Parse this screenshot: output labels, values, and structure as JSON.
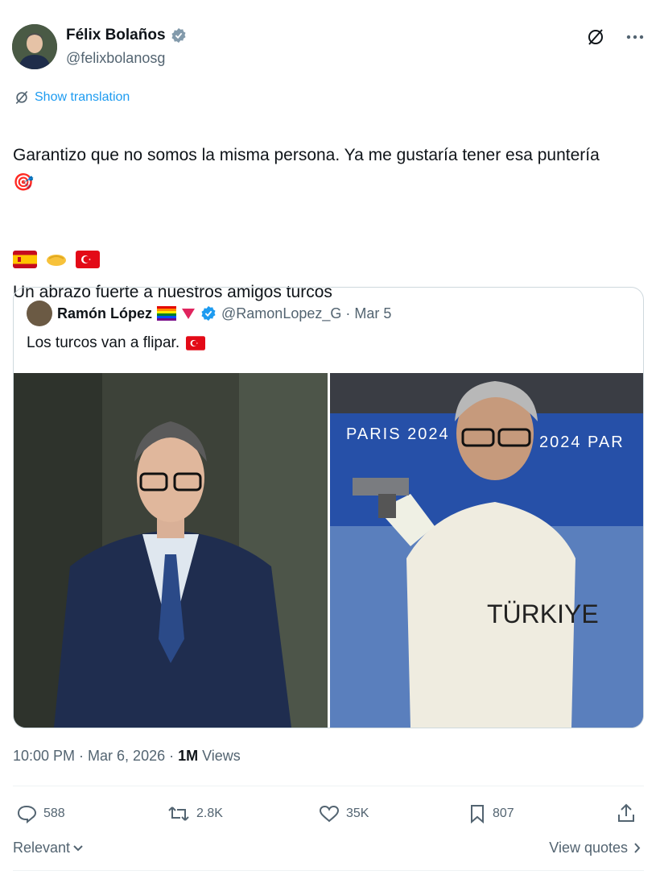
{
  "author": {
    "name": "Félix Bolaños",
    "handle": "@felixbolanosg"
  },
  "translate_label": "Show translation",
  "tweet": {
    "line1": "Garantizo que no somos la misma persona. Ya me gustaría tener esa puntería 🎯",
    "line2": "Un abrazo fuerte a nuestros amigos turcos"
  },
  "quote": {
    "name": "Ramón López",
    "handle": "@RamonLopez_G · Mar 5",
    "text": "Los turcos van a flipar."
  },
  "meta": {
    "time": "10:00 PM · Mar 6, 2026 · ",
    "views_count": "1M",
    "views_label": " Views"
  },
  "actions": {
    "replies": "588",
    "reposts": "2.8K",
    "likes": "35K",
    "bookmarks": "807"
  },
  "bottom": {
    "relevant": "Relevant",
    "view_quotes": "View quotes"
  },
  "colors": {
    "accent": "#1d9bf0",
    "muted": "#536471",
    "text": "#0f1419"
  }
}
